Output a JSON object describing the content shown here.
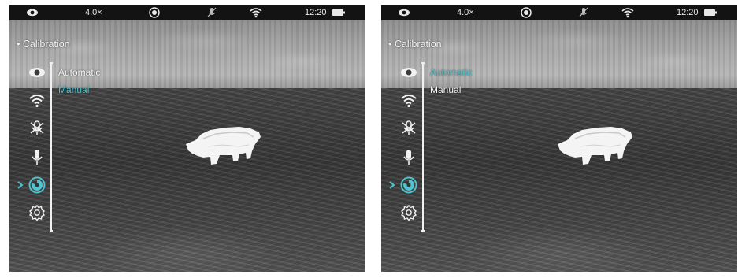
{
  "screens": [
    {
      "status": {
        "zoom": "4.0×",
        "time": "12:20"
      },
      "menu_title": "• Calibration",
      "options": [
        {
          "label": "Automatic",
          "selected": false
        },
        {
          "label": "Manual",
          "selected": true
        }
      ],
      "sidebar_icons": [
        "eye-icon",
        "wifi-icon",
        "microphone-off-icon",
        "microphone-icon",
        "calibration-icon",
        "settings-icon"
      ],
      "active_icon": "calibration-icon"
    },
    {
      "status": {
        "zoom": "4.0×",
        "time": "12:20"
      },
      "menu_title": "• Calibration",
      "options": [
        {
          "label": "Automatic",
          "selected": true
        },
        {
          "label": "Manual",
          "selected": false
        }
      ],
      "sidebar_icons": [
        "eye-icon",
        "wifi-icon",
        "microphone-off-icon",
        "microphone-icon",
        "calibration-icon",
        "settings-icon"
      ],
      "active_icon": "calibration-icon"
    }
  ],
  "colors": {
    "accent": "#4fc3cf",
    "statusbar": "#131313",
    "text": "#f2f2f2"
  }
}
